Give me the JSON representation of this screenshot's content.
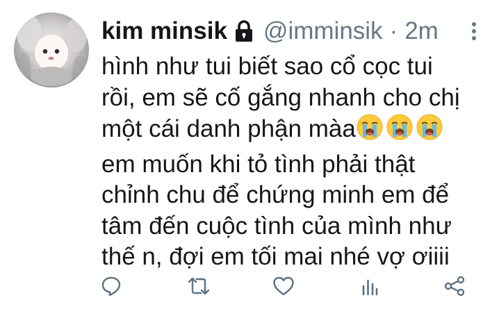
{
  "tweet": {
    "author_name": "kim minsik",
    "handle": "@imminsik",
    "separator": "·",
    "time": "2m",
    "text_lines": [
      "hình như tui biết sao cổ cọc tui",
      "rồi, em sẽ cố gắng nhanh cho chị",
      "một cái danh phận màa",
      "em muốn khi tỏ tình phải thật",
      "chỉnh chu để chứng minh em để",
      "tâm đến cuộc tình của mình như",
      "thế n, đợi em tối mai nhé vợ ơiiii"
    ],
    "emoji_name": "loudly-crying-face"
  },
  "icons": {
    "lock": "lock-icon",
    "more": "more-options-icon",
    "reply": "reply-icon",
    "retweet": "retweet-icon",
    "like": "like-icon",
    "analytics": "analytics-icon",
    "share": "share-icon"
  },
  "colors": {
    "text": "#14171a",
    "secondary": "#657786",
    "action_icon": "#5b7083"
  }
}
